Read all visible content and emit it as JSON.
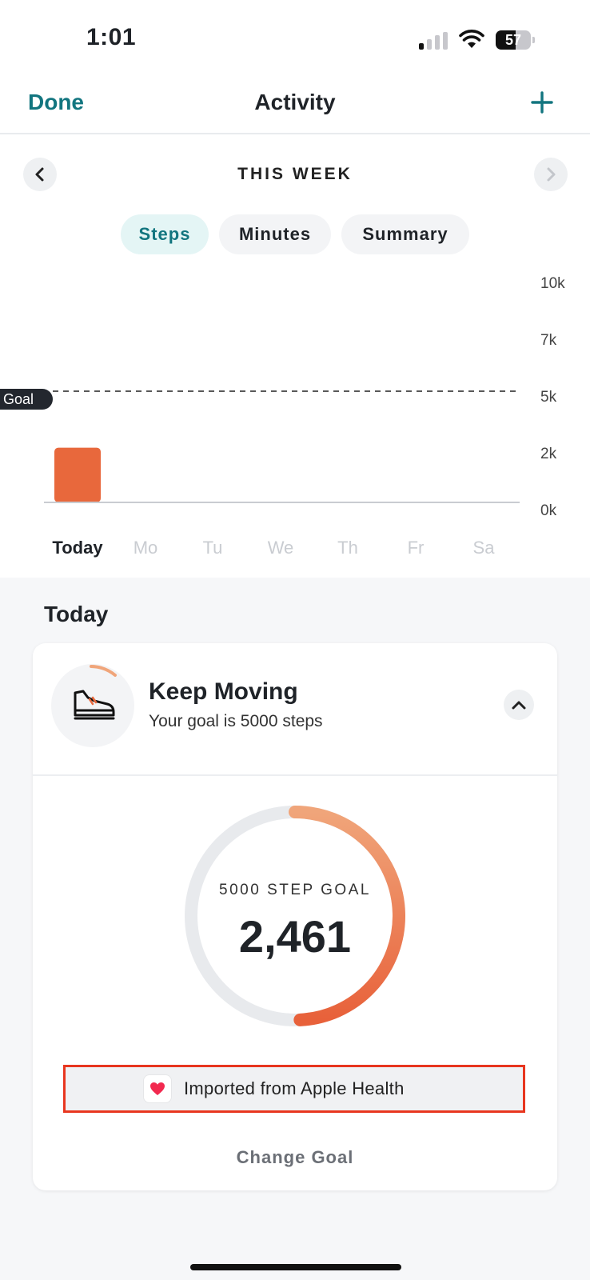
{
  "status_bar": {
    "time": "1:01",
    "battery": "57",
    "battery_level": 0.57,
    "signal_bars_on": 1,
    "signal_bars_total": 4
  },
  "nav": {
    "done_label": "Done",
    "title": "Activity",
    "add_icon": "plus-icon"
  },
  "week_nav": {
    "title": "THIS WEEK",
    "prev_icon": "chevron-left-icon",
    "next_icon": "chevron-right-icon"
  },
  "tabs": [
    {
      "label": "Steps",
      "active": true
    },
    {
      "label": "Minutes",
      "active": false
    },
    {
      "label": "Summary",
      "active": false
    }
  ],
  "chart_data": {
    "type": "bar",
    "categories": [
      "Today",
      "Mo",
      "Tu",
      "We",
      "Th",
      "Fr",
      "Sa"
    ],
    "values": [
      2461,
      0,
      0,
      0,
      0,
      0,
      0
    ],
    "y_ticks": [
      "10k",
      "7k",
      "5k",
      "2k",
      "0k"
    ],
    "ylim": [
      0,
      10000
    ],
    "goal_label": "Goal",
    "goal_value": 5000,
    "bar_color": "#e8683c",
    "grid": false
  },
  "today": {
    "heading": "Today",
    "card": {
      "title": "Keep Moving",
      "subtitle": "Your goal is 5000 steps",
      "icon": "shoe-icon",
      "collapse_icon": "chevron-up-icon"
    },
    "ring": {
      "label": "5000 STEP GOAL",
      "value": "2,461",
      "progress": 0.4922,
      "color_start": "#f0a57a",
      "color_end": "#e8613a",
      "track_color": "#e8eaed"
    },
    "import_source": "Imported from Apple Health",
    "change_goal": "Change Goal"
  },
  "colors": {
    "accent": "#12757f",
    "highlight_border": "#e8361f"
  }
}
